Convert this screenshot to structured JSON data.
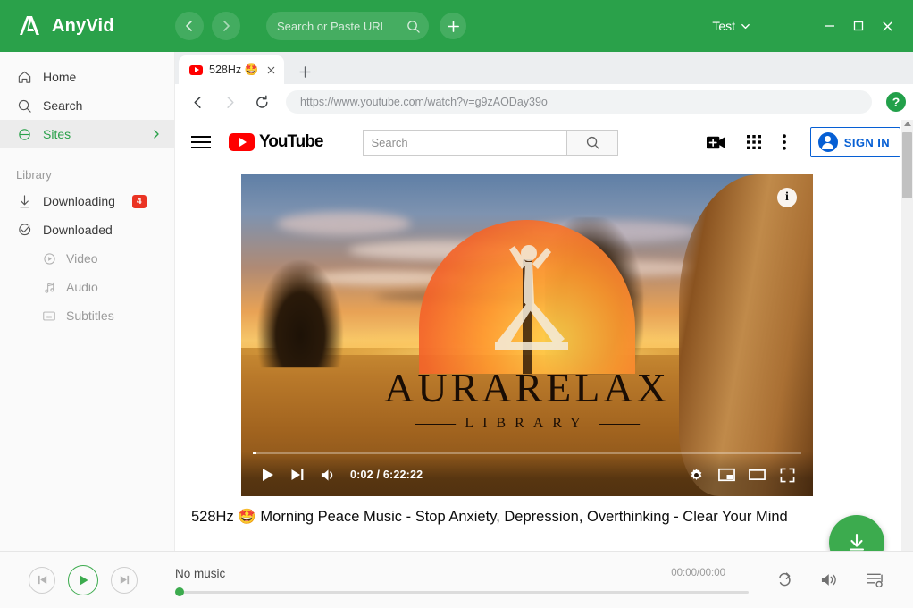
{
  "app": {
    "name": "AnyVid",
    "logo_icon": "anyvid-logo-icon"
  },
  "titlebar": {
    "back_icon": "chevron-left-icon",
    "forward_icon": "chevron-right-icon",
    "search_placeholder": "Search or Paste URL",
    "search_value": "",
    "search_icon": "search-icon",
    "new_tab_icon": "plus-icon",
    "account_label": "Test",
    "account_caret_icon": "chevron-down-icon",
    "minimize_icon": "minimize-icon",
    "maximize_icon": "maximize-icon",
    "close_icon": "close-icon"
  },
  "sidebar": {
    "items": [
      {
        "label": "Home",
        "icon": "home-icon",
        "active": false
      },
      {
        "label": "Search",
        "icon": "search-icon",
        "active": false
      },
      {
        "label": "Sites",
        "icon": "sites-globe-icon",
        "active": true,
        "chevron": "chevron-right-icon"
      }
    ],
    "group_label": "Library",
    "library": [
      {
        "label": "Downloading",
        "icon": "download-arrow-icon",
        "badge": "4"
      },
      {
        "label": "Downloaded",
        "icon": "check-circle-icon",
        "badge": ""
      }
    ],
    "sub_items": [
      {
        "label": "Video",
        "icon": "play-circle-icon"
      },
      {
        "label": "Audio",
        "icon": "music-note-icon"
      },
      {
        "label": "Subtitles",
        "icon": "closed-caption-icon"
      }
    ]
  },
  "browser": {
    "tab": {
      "favicon": "youtube-favicon-icon",
      "title": "528Hz 🤩",
      "close_icon": "close-icon"
    },
    "new_tab_icon": "plus-icon",
    "nav": {
      "back_icon": "arrow-back-icon",
      "forward_icon": "arrow-forward-icon",
      "reload_icon": "reload-icon"
    },
    "address": "https://www.youtube.com/watch?v=g9zAODay39o",
    "help_label": "?",
    "help_icon": "help-circle-icon"
  },
  "youtube": {
    "menu_icon": "hamburger-menu-icon",
    "logo_text": "YouTube",
    "logo_icon": "youtube-logo-icon",
    "search_placeholder": "Search",
    "search_value": "",
    "search_button_icon": "search-icon",
    "create_icon": "video-camera-plus-icon",
    "apps_icon": "apps-grid-icon",
    "more_icon": "more-vertical-icon",
    "signin_label": "SIGN IN",
    "signin_avatar_icon": "account-circle-icon"
  },
  "player": {
    "info_badge": "i",
    "thumbnail_logo_main": "AURARELAX",
    "thumbnail_logo_sub": "LIBRARY",
    "play_icon": "play-icon",
    "next_icon": "next-track-icon",
    "volume_icon": "volume-on-icon",
    "time_current": "0:02",
    "time_total": "6:22:22",
    "time_display": "0:02 / 6:22:22",
    "settings_icon": "gear-icon",
    "miniplayer_icon": "miniplayer-icon",
    "theater_icon": "theater-mode-icon",
    "fullscreen_icon": "fullscreen-icon",
    "progress_percent": 0
  },
  "video": {
    "title": "528Hz 🤩 Morning Peace Music - Stop Anxiety, Depression, Overthinking - Clear Your Mind"
  },
  "download_fab": {
    "icon": "download-icon"
  },
  "musicbar": {
    "prev_icon": "skip-previous-icon",
    "play_icon": "play-icon",
    "next_icon": "skip-next-icon",
    "track_title": "No music",
    "time": "00:00/00:00",
    "repeat_icon": "repeat-icon",
    "volume_icon": "volume-on-icon",
    "queue_icon": "playlist-queue-icon",
    "progress_percent": 0
  },
  "colors": {
    "brand_green": "#2aa14a",
    "accent_green": "#3cab4e",
    "badge_red": "#ea3323",
    "youtube_red": "#ff0000",
    "signin_blue": "#065fd4"
  }
}
